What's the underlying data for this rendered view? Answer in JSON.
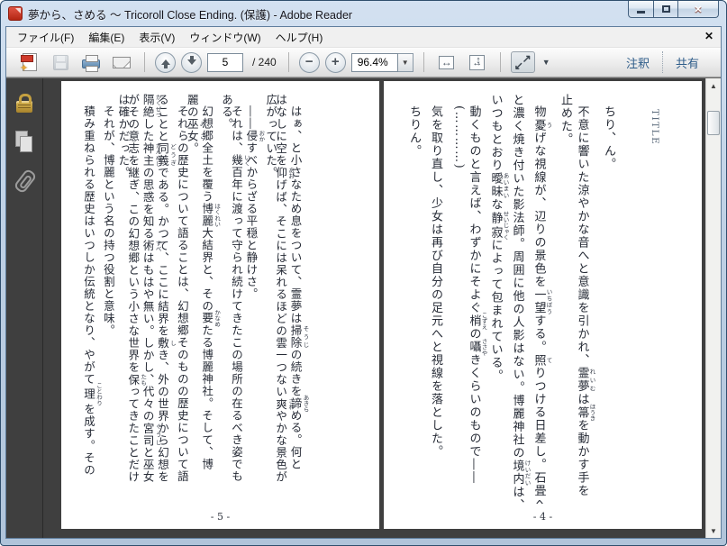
{
  "window": {
    "title": "夢から、さめる ～ Tricoroll Close Ending. (保護) - Adobe Reader"
  },
  "menu_bar": {
    "items": [
      {
        "label": "ファイル(F)"
      },
      {
        "label": "編集(E)"
      },
      {
        "label": "表示(V)"
      },
      {
        "label": "ウィンドウ(W)"
      },
      {
        "label": "ヘルプ(H)"
      }
    ],
    "close_glyph": "✕"
  },
  "toolbar": {
    "page_current": "5",
    "page_total_label": "/ 240",
    "zoom_value": "96.4%",
    "annotations_label": "注釈",
    "share_label": "共有",
    "accent_link_color": "#2f5d8a"
  },
  "document": {
    "background_color": "#3f3f3f",
    "pages": [
      {
        "side": "left",
        "number_label": "- 5 -",
        "columns": [
          {
            "indent": 1,
            "segments": [
              {
                "t": "はぁ、と小さなため息をついて、霊夢は"
              },
              {
                "t": "掃除",
                "r": "そうじ"
              },
              {
                "t": "の続きを"
              },
              {
                "t": "諦",
                "r": "あきら"
              },
              {
                "t": "める。何と"
              }
            ]
          },
          {
            "indent": 0,
            "segments": [
              {
                "t": "はなしに空を"
              },
              {
                "t": "仰",
                "r": "あお"
              },
              {
                "t": "げば、そこには呆れるほどの雲一つない"
              },
              {
                "t": "爽",
                "r": "さわ"
              },
              {
                "t": "やかな景色が"
              }
            ]
          },
          {
            "indent": 0,
            "segments": [
              {
                "t": "広がっていた。"
              }
            ]
          },
          {
            "indent": 1,
            "segments": [
              {
                "t": "――"
              },
              {
                "t": "侵",
                "r": "おか"
              },
              {
                "t": "すべからざる平穏と静けさ。"
              }
            ]
          },
          {
            "indent": 1,
            "segments": [
              {
                "t": "それは、"
              },
              {
                "t": "幾",
                "r": "いく"
              },
              {
                "t": "百年に渡って守られ続けてきたこの場所の在るべき姿でも"
              }
            ]
          },
          {
            "indent": 0,
            "segments": [
              {
                "t": "ある。"
              }
            ]
          },
          {
            "indent": 1,
            "segments": [
              {
                "t": "幻想郷全土を覆う"
              },
              {
                "t": "博麗",
                "r": "はくれい"
              },
              {
                "t": "大結界と、その"
              },
              {
                "t": "要",
                "r": "かなめ"
              },
              {
                "t": "たる博麗神社。そして、博"
              }
            ]
          },
          {
            "indent": 0,
            "segments": [
              {
                "t": "麗の"
              },
              {
                "t": "巫女",
                "r": "みこ"
              },
              {
                "t": "。"
              }
            ]
          },
          {
            "indent": 1,
            "segments": [
              {
                "t": "それらの歴史について語ることは、幻想郷そのものの歴史について語"
              }
            ]
          },
          {
            "indent": 0,
            "segments": [
              {
                "t": "ることと"
              },
              {
                "t": "同義",
                "r": "どうぎ"
              },
              {
                "t": "である。かつて、ここに結界を"
              },
              {
                "t": "敷",
                "r": "し"
              },
              {
                "t": "き、外の世界から幻想を"
              }
            ]
          },
          {
            "indent": 0,
            "segments": [
              {
                "t": "隔絶",
                "r": "かくぜつ"
              },
              {
                "t": "した"
              },
              {
                "t": "神主",
                "r": "かんぬし"
              },
              {
                "t": "の思惑を知る"
              },
              {
                "t": "術",
                "r": "すべ"
              },
              {
                "t": "はもはや無い。しかし、代々の"
              },
              {
                "t": "宮司",
                "r": "ぐうじ"
              },
              {
                "t": "と巫女"
              }
            ]
          },
          {
            "indent": 0,
            "segments": [
              {
                "t": "がその意志を継ぎ、この幻想郷という小さな世界を"
              },
              {
                "t": "保",
                "r": "たも"
              },
              {
                "t": "ってきたことだけ"
              }
            ]
          },
          {
            "indent": 0,
            "segments": [
              {
                "t": "は確かだった。"
              }
            ]
          },
          {
            "indent": 1,
            "segments": [
              {
                "t": "それが、博麗という名の持つ役割と意味。"
              }
            ]
          },
          {
            "indent": 1,
            "segments": [
              {
                "t": "積み重ねられる歴史はいつしか伝統となり、やがて"
              },
              {
                "t": "理",
                "r": "ことわり"
              },
              {
                "t": "を成す。その"
              }
            ]
          }
        ]
      },
      {
        "side": "right",
        "number_label": "- 4 -",
        "columns": [
          {
            "cls": "title-col",
            "indent": 1.6,
            "segments": [
              {
                "t": "TITLE"
              }
            ]
          },
          {
            "indent": 0,
            "segments": []
          },
          {
            "indent": 1,
            "segments": [
              {
                "t": "ちり、ん。"
              }
            ]
          },
          {
            "indent": 1,
            "segments": [
              {
                "t": "不意に響いた涼やかな音へと意識を引かれ、"
              },
              {
                "t": "霊夢",
                "r": "れいむ"
              },
              {
                "t": "は"
              },
              {
                "t": "箒",
                "r": "ほうき"
              },
              {
                "t": "を動かす手を"
              }
            ]
          },
          {
            "indent": 0,
            "segments": [
              {
                "t": "止めた。"
              }
            ]
          },
          {
            "indent": 1,
            "segments": [
              {
                "t": "物"
              },
              {
                "t": "憂",
                "r": "う"
              },
              {
                "t": "げな視線が、辺りの景色を"
              },
              {
                "t": "一望",
                "r": "いちぼう"
              },
              {
                "t": "する。"
              },
              {
                "t": "照",
                "r": "て"
              },
              {
                "t": "りつける日差し。石畳へ"
              }
            ]
          },
          {
            "indent": 0,
            "segments": [
              {
                "t": "と濃く焼き付いた影法師。周囲に他の人影はない。博麗神社の"
              },
              {
                "t": "境内",
                "r": "けいだい"
              },
              {
                "t": "は、"
              }
            ]
          },
          {
            "indent": 0,
            "segments": [
              {
                "t": "いつもとおり"
              },
              {
                "t": "曖昧",
                "r": "あいまい"
              },
              {
                "t": "な"
              },
              {
                "t": "静寂",
                "r": "せいじゃく"
              },
              {
                "t": "によって包まれている。"
              }
            ]
          },
          {
            "indent": 1,
            "segments": [
              {
                "t": "動くものと言えば、わずかにそよぐ"
              },
              {
                "t": "梢",
                "r": "こずえ"
              },
              {
                "t": "の"
              },
              {
                "t": "囁",
                "r": "ささや"
              },
              {
                "t": "きくらいのもので――"
              }
            ]
          },
          {
            "indent": 1,
            "segments": [
              {
                "t": "(…………)"
              }
            ]
          },
          {
            "indent": 1,
            "segments": [
              {
                "t": "気を取り直し、少女は再び自分の足元へと視線を落とした。"
              }
            ]
          },
          {
            "indent": 1,
            "segments": [
              {
                "t": "ちりん。"
              }
            ]
          }
        ]
      }
    ]
  }
}
